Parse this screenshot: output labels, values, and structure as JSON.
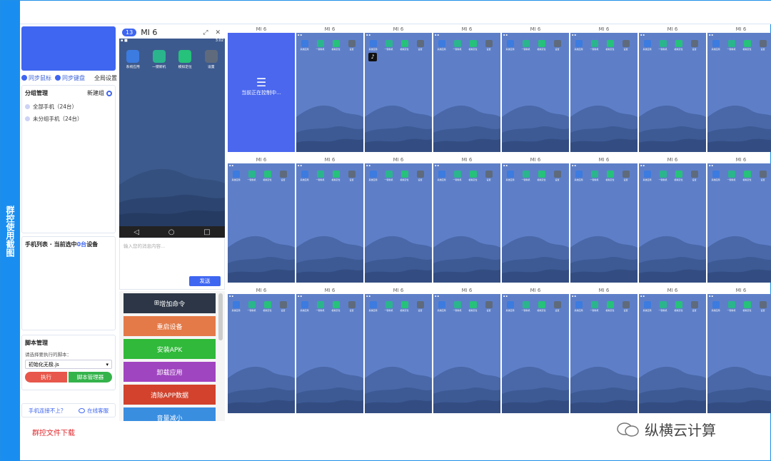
{
  "side_tab": {
    "label": "群控使用截图"
  },
  "left": {
    "sync": {
      "mouse": "同步鼠标",
      "keyboard": "同步键盘",
      "global": "全局设置"
    },
    "group": {
      "title": "分组管理",
      "new": "新建组",
      "items": [
        "全部手机（24台）",
        "未分组手机（24台）"
      ]
    },
    "list": {
      "title_prefix": "手机列表 · 当前选中",
      "count": "0台",
      "suffix": "设备"
    },
    "script": {
      "title": "脚本管理",
      "label": "请选择要执行的脚本：",
      "selected": "初始化无极.js",
      "exec": "执行",
      "manager": "脚本管理器"
    },
    "help": {
      "question": "手机连接不上？",
      "service": "在线客服"
    },
    "download": "群控文件下载"
  },
  "control": {
    "num": "13",
    "name": "MI 6",
    "time": "3:02",
    "apps": [
      {
        "name": "系统应用",
        "icon": "apps-icon",
        "color": "#3c7be0"
      },
      {
        "name": "一键新机",
        "icon": "phone-icon",
        "color": "#2ab58d"
      },
      {
        "name": "模拟定位",
        "icon": "location-icon",
        "color": "#26c17a"
      },
      {
        "name": "设置",
        "icon": "settings-icon",
        "color": "#5f6b7c"
      }
    ],
    "message_placeholder": "输入您的消息内容...",
    "send": "发送"
  },
  "commands": [
    {
      "label": "增加命令",
      "color": "#2c3646"
    },
    {
      "label": "重启设备",
      "color": "#e47a48"
    },
    {
      "label": "安装APK",
      "color": "#30b93a"
    },
    {
      "label": "卸载应用",
      "color": "#a045c0"
    },
    {
      "label": "清除APP数据",
      "color": "#d2422c"
    },
    {
      "label": "音量减小",
      "color": "#3a8ee0"
    }
  ],
  "grid": {
    "device_name": "MI 6",
    "controlling_text": "当前正在控制中...",
    "app_labels": [
      "系统应用",
      "一键新机",
      "模拟定位",
      "设置"
    ],
    "tiktok_label": "抖音"
  },
  "watermark": "纵横云计算"
}
